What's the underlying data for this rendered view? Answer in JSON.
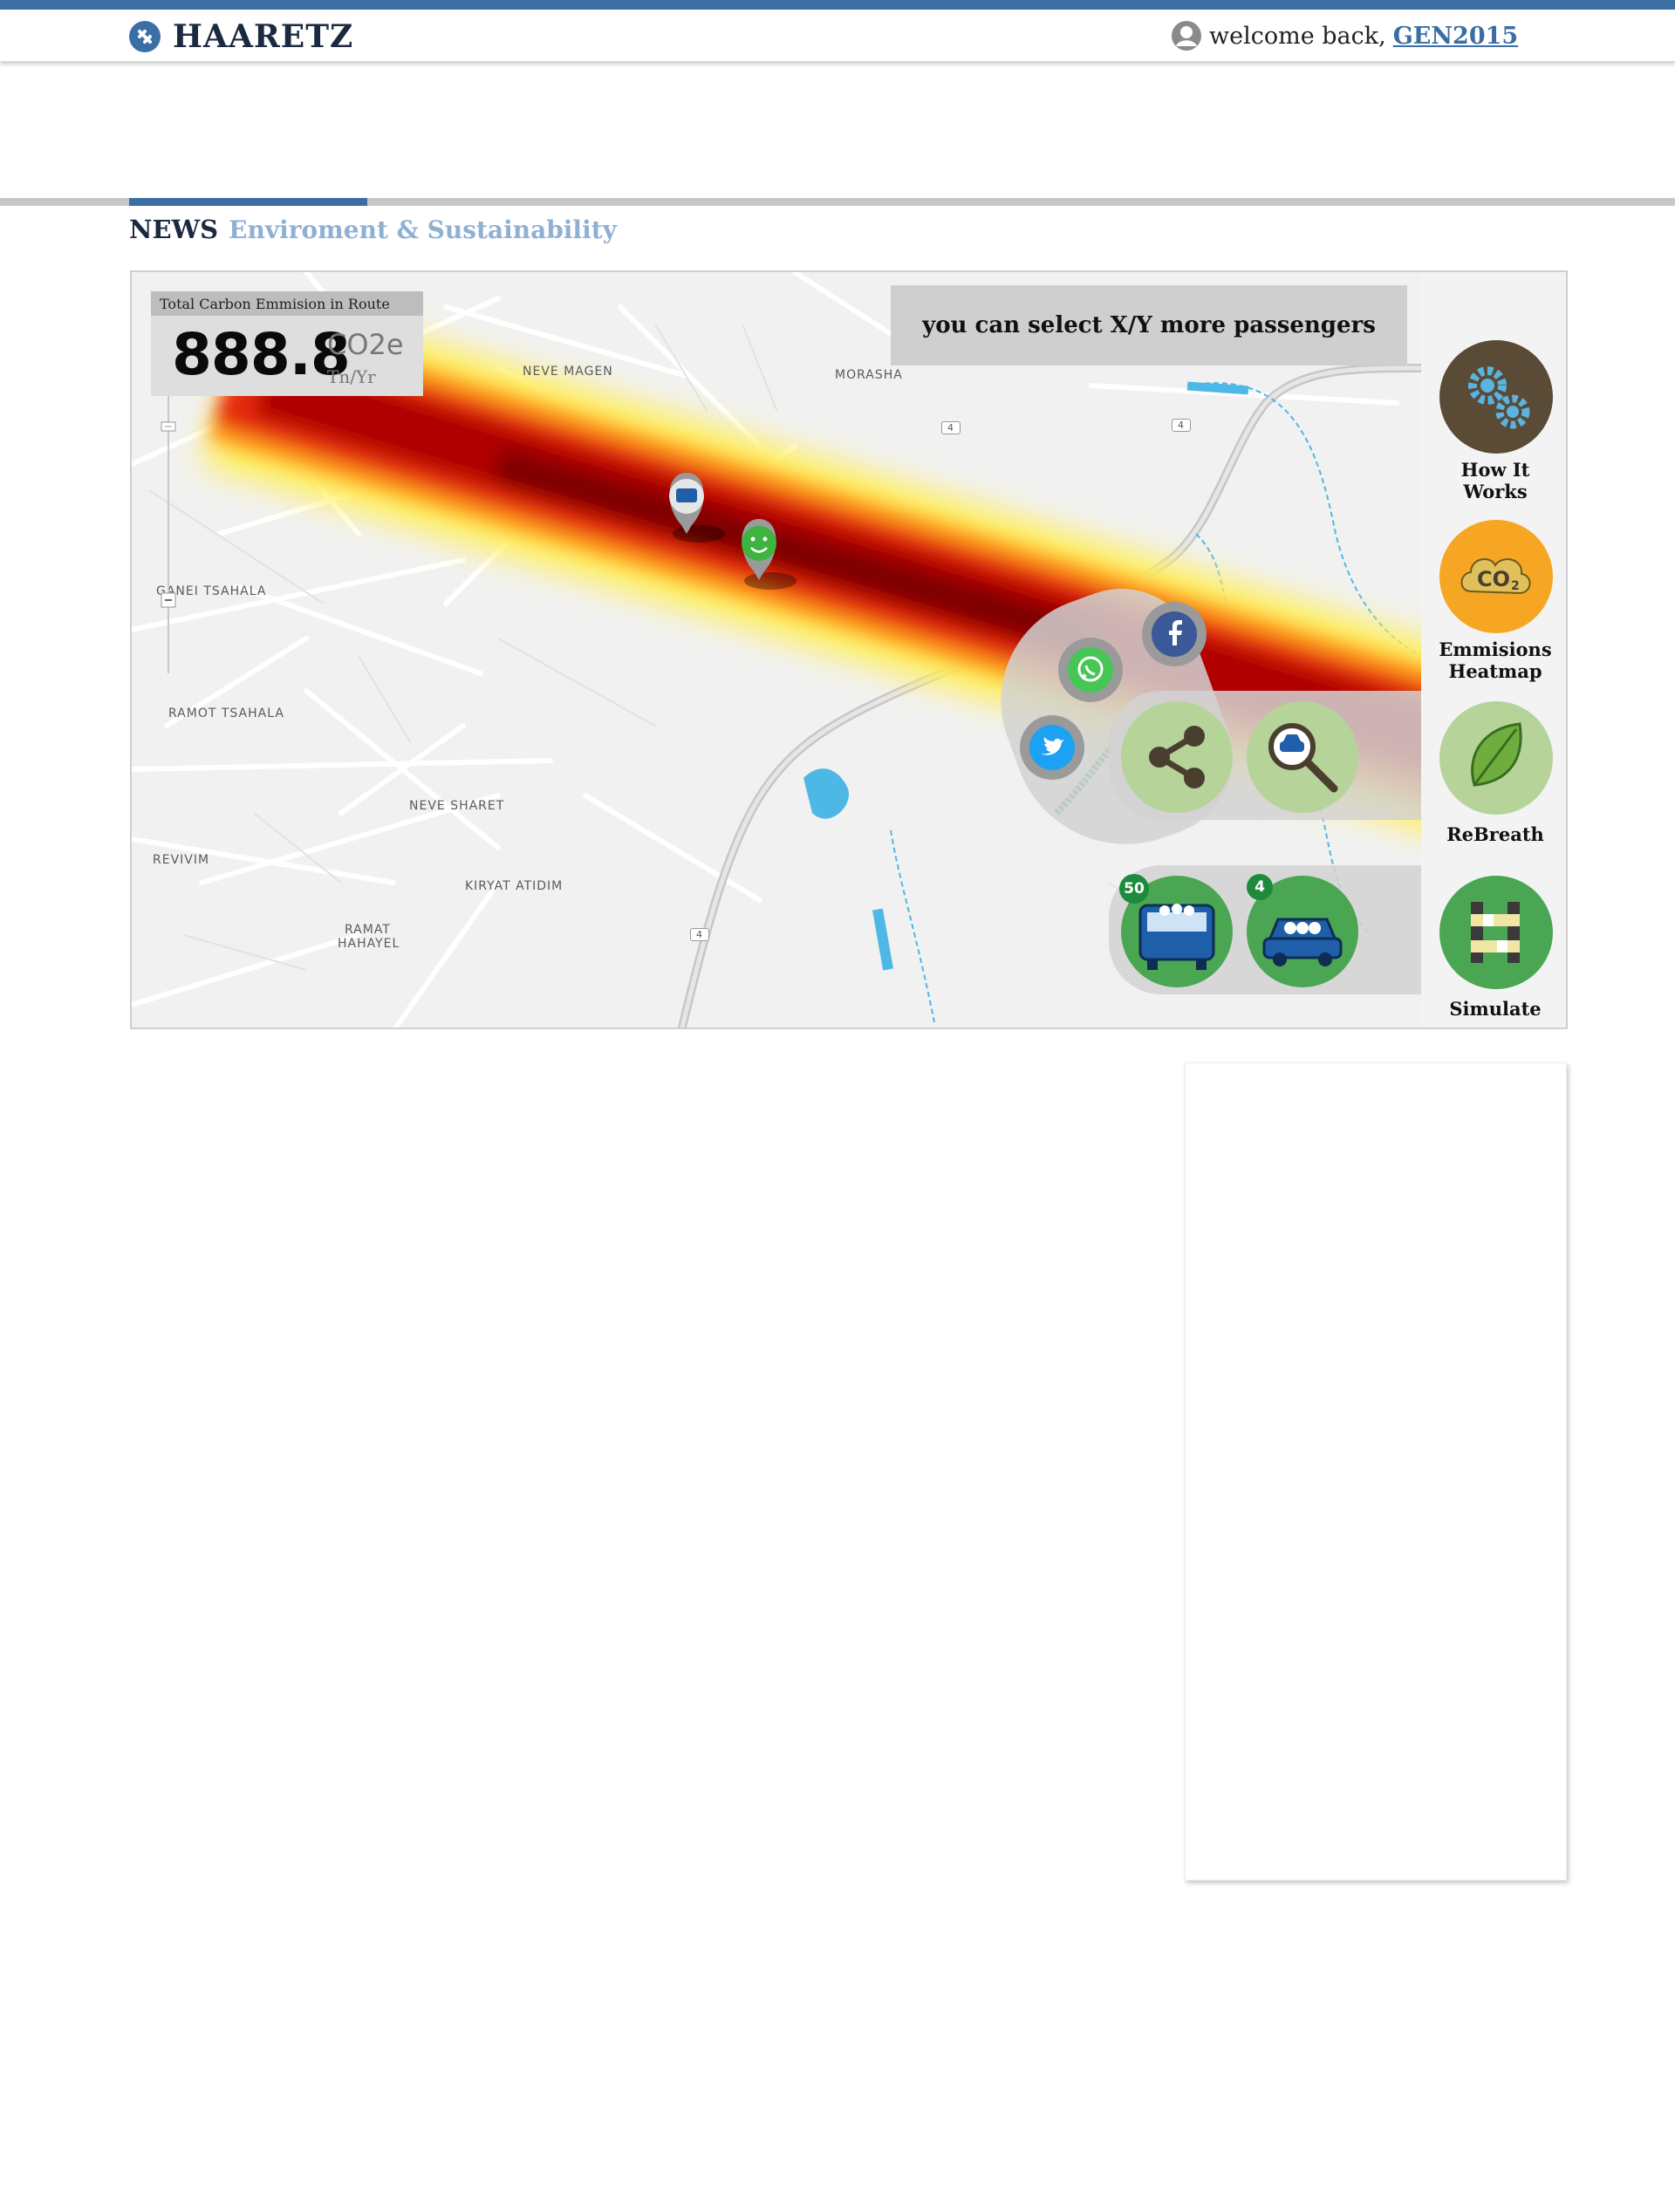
{
  "header": {
    "brand": "HAARETZ",
    "welcome_text": "welcome back,",
    "username": "GEN2015",
    "brand_color": "#3a6ea5"
  },
  "section": {
    "primary": "NEWS",
    "secondary": "Enviroment & Sustainability"
  },
  "emissions": {
    "title": "Total Carbon Emmision in Route",
    "value": "888.8",
    "unit": "CO2e",
    "unit_sub": "Tn/Yr"
  },
  "notice": {
    "text": "you can select X/Y more passengers"
  },
  "sidebar": {
    "items": [
      {
        "label_line1": "How It",
        "label_line2": "Works",
        "icon": "gears-icon"
      },
      {
        "label_line1": "Emmisions",
        "label_line2": "Heatmap",
        "icon": "co2-cloud-icon"
      },
      {
        "label_line1": "ReBreath",
        "label_line2": "",
        "icon": "leaf-icon"
      },
      {
        "label_line1": "Simulate",
        "label_line2": "",
        "icon": "route-simulate-icon"
      }
    ]
  },
  "vehicles": {
    "bus_count": "50",
    "car_count": "4"
  },
  "map_labels": {
    "neve_magen": "NEVE MAGEN",
    "morasha": "MORASHA",
    "ganei_tsahala": "GANEI TSAHALA",
    "ramot_tsahala": "RAMOT TSAHALA",
    "neve_sharet": "NEVE SHARET",
    "revivim": "REVIVIM",
    "kiryat_atidim": "KIRYAT ATIDIM",
    "ramat": "RAMAT",
    "hahayel": "HAHAYEL",
    "route_4": "4"
  },
  "share": {
    "facebook_icon": "facebook-icon",
    "whatsapp_icon": "whatsapp-icon",
    "twitter_icon": "twitter-icon"
  },
  "colors": {
    "heat_core": "#a80000",
    "heat_mid": "#e8200a",
    "heat_outer": "#ffe600",
    "panel_green": "#b6d39a",
    "bubble_green": "#4aa652"
  }
}
